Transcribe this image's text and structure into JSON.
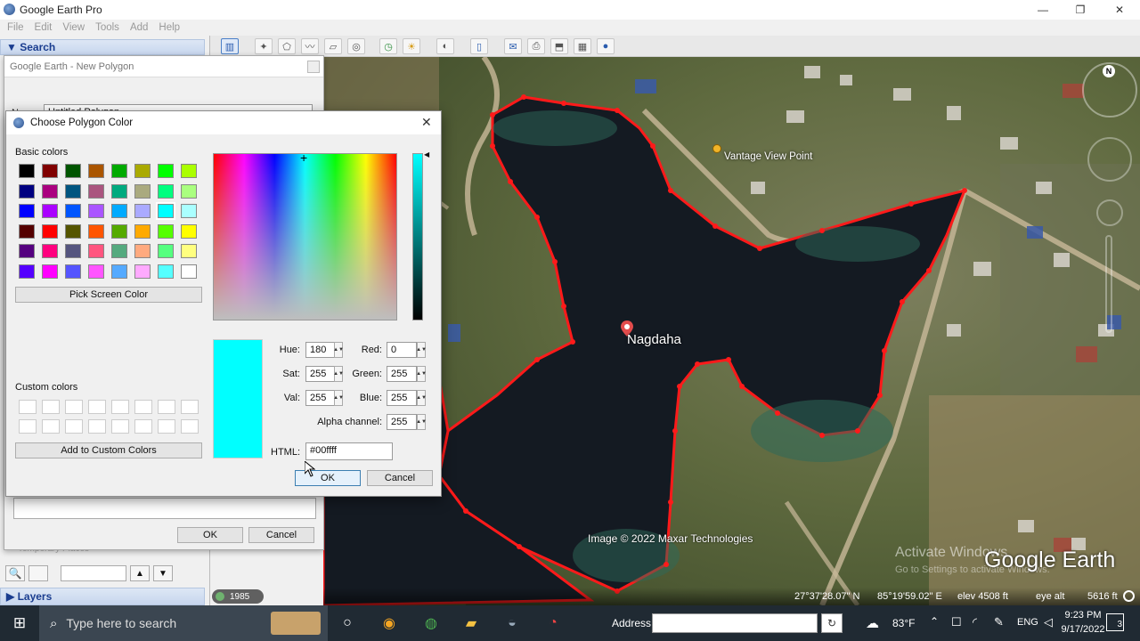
{
  "app": {
    "title": "Google Earth Pro",
    "min": "—",
    "max": "❐",
    "close": "✕"
  },
  "menu": [
    "File",
    "Edit",
    "View",
    "Tools",
    "Add",
    "Help"
  ],
  "left_panel": {
    "search_header": "▼ Search",
    "layers_header": "▶ Layers",
    "temp_places": "Temporary Places"
  },
  "new_polygon": {
    "title": "Google Earth - New Polygon",
    "name_label": "Name:",
    "name_value": "Untitled Polygon",
    "ok": "OK",
    "cancel": "Cancel"
  },
  "color_dialog": {
    "title": "Choose Polygon Color",
    "basic_colors_label": "Basic colors",
    "pick_screen": "Pick Screen Color",
    "custom_colors_label": "Custom colors",
    "add_custom": "Add to Custom Colors",
    "hue_label": "Hue:",
    "hue": "180",
    "sat_label": "Sat:",
    "sat": "255",
    "val_label": "Val:",
    "val": "255",
    "red_label": "Red:",
    "red": "0",
    "green_label": "Green:",
    "green": "255",
    "blue_label": "Blue:",
    "blue": "255",
    "alpha_label": "Alpha channel:",
    "alpha": "255",
    "html_label": "HTML:",
    "html": "#00ffff",
    "ok": "OK",
    "cancel": "Cancel",
    "selected_color": "#00ffff",
    "basic_colors": [
      "#000000",
      "#800000",
      "#005500",
      "#aa5500",
      "#00aa00",
      "#aaaa00",
      "#00ff00",
      "#aaff00",
      "#000080",
      "#aa007f",
      "#005580",
      "#aa557f",
      "#00aa7f",
      "#aaaa7f",
      "#00ff7f",
      "#aaff7f",
      "#0000ff",
      "#aa00ff",
      "#0055ff",
      "#aa55ff",
      "#00aaff",
      "#aaaaff",
      "#00ffff",
      "#aaffff",
      "#550000",
      "#ff0000",
      "#555500",
      "#ff5500",
      "#55aa00",
      "#ffaa00",
      "#55ff00",
      "#ffff00",
      "#55007f",
      "#ff007f",
      "#55557f",
      "#ff557f",
      "#55aa7f",
      "#ffaa7f",
      "#55ff7f",
      "#ffff7f",
      "#5500ff",
      "#ff00ff",
      "#5555ff",
      "#ff55ff",
      "#55aaff",
      "#ffaaff",
      "#55ffff",
      "#ffffff"
    ]
  },
  "map": {
    "place_label": "Nagdaha",
    "poi_label": "Vantage View Point",
    "copyright": "Image © 2022 Maxar Technologies",
    "brand": "Google Earth",
    "watermark1": "Activate Windows",
    "watermark2": "Go to Settings to activate Windows.",
    "year": "1985",
    "lat": "27°37'28.07\" N",
    "lon": "85°19'59.02\" E",
    "elev": "elev 4508 ft",
    "eye_alt_label": "eye alt",
    "eye_alt": "5616 ft",
    "compass_n": "N",
    "polygon_color": "#ff1a1a"
  },
  "taskbar": {
    "search_placeholder": "Type here to search",
    "address_label": "Address",
    "temp": "83°F",
    "lang": "ENG",
    "time": "9:23 PM",
    "date": "9/17/2022",
    "notif": "3"
  }
}
